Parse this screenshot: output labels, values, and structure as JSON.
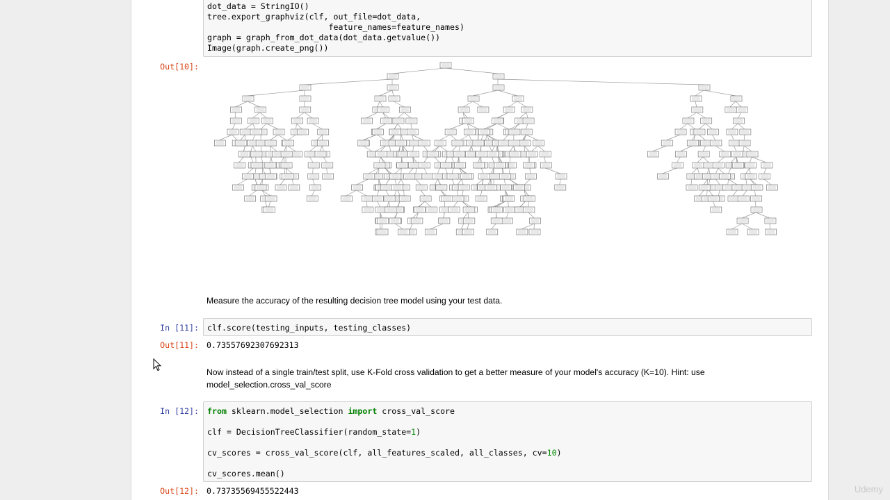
{
  "cell10": {
    "code_lines": [
      "dot_data = StringIO()",
      "tree.export_graphviz(clf, out_file=dot_data,",
      "                         feature_names=feature_names)",
      "graph = graph_from_dot_data(dot_data.getvalue())",
      "Image(graph.create_png())"
    ],
    "out_prompt": "Out[10]:"
  },
  "md1": {
    "text": "Measure the accuracy of the resulting decision tree model using your test data."
  },
  "cell11": {
    "in_prompt": "In [11]:",
    "code": "clf.score(testing_inputs, testing_classes)",
    "out_prompt": "Out[11]:",
    "output": "0.73557692307692313"
  },
  "md2": {
    "line1": "Now instead of a single train/test split, use K-Fold cross validation to get a better measure of your model's accuracy (K=10). Hint: use",
    "line2": "model_selection.cross_val_score"
  },
  "cell12": {
    "in_prompt": "In [12]:",
    "line1_kw1": "from",
    "line1_mid": " sklearn.model_selection ",
    "line1_kw2": "import",
    "line1_end": " cross_val_score",
    "line2_pre": "clf = DecisionTreeClassifier(random_state=",
    "line2_num": "1",
    "line2_post": ")",
    "line3_pre": "cv_scores = cross_val_score(clf, all_features_scaled, all_classes, cv=",
    "line3_num": "10",
    "line3_post": ")",
    "line4": "cv_scores.mean()",
    "out_prompt": "Out[12]:",
    "output": "0.73735569455522443"
  },
  "watermark": "Udemy",
  "icons": {
    "cursor": "arrow-cursor-icon",
    "tree": "decision-tree-graph-image"
  }
}
